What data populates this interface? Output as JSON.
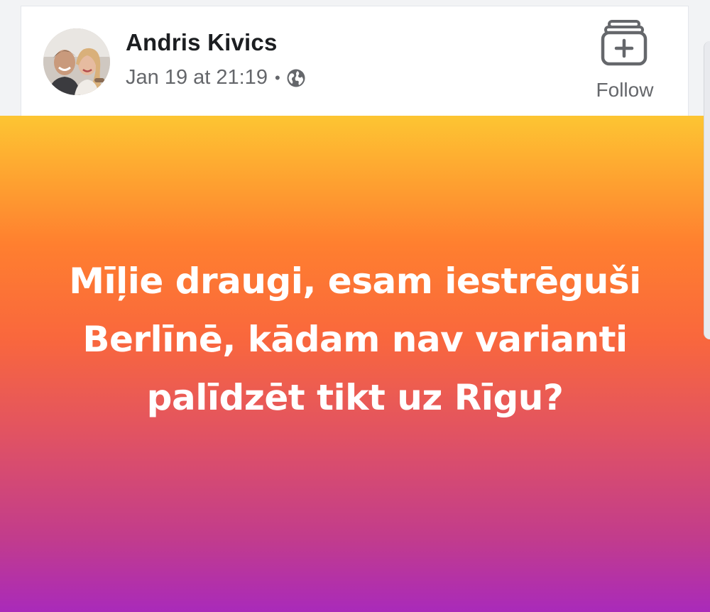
{
  "post": {
    "author": "Andris Kivics",
    "timestamp": "Jan 19 at 21:19",
    "separator": "•",
    "privacy_icon": "globe-icon",
    "text": "Mīļie draugi, esam iestrēguši Berlīnē, kādam nav varianti palīdzēt tikt uz Rīgu?",
    "background_gradient": [
      "#fdc532",
      "#ff7f2f",
      "#e4555e",
      "#a92aba"
    ]
  },
  "actions": {
    "follow_label": "Follow",
    "follow_icon": "add-to-collection-icon"
  },
  "colors": {
    "author": "#1c1e21",
    "meta": "#65676b",
    "post_text": "#ffffff"
  }
}
